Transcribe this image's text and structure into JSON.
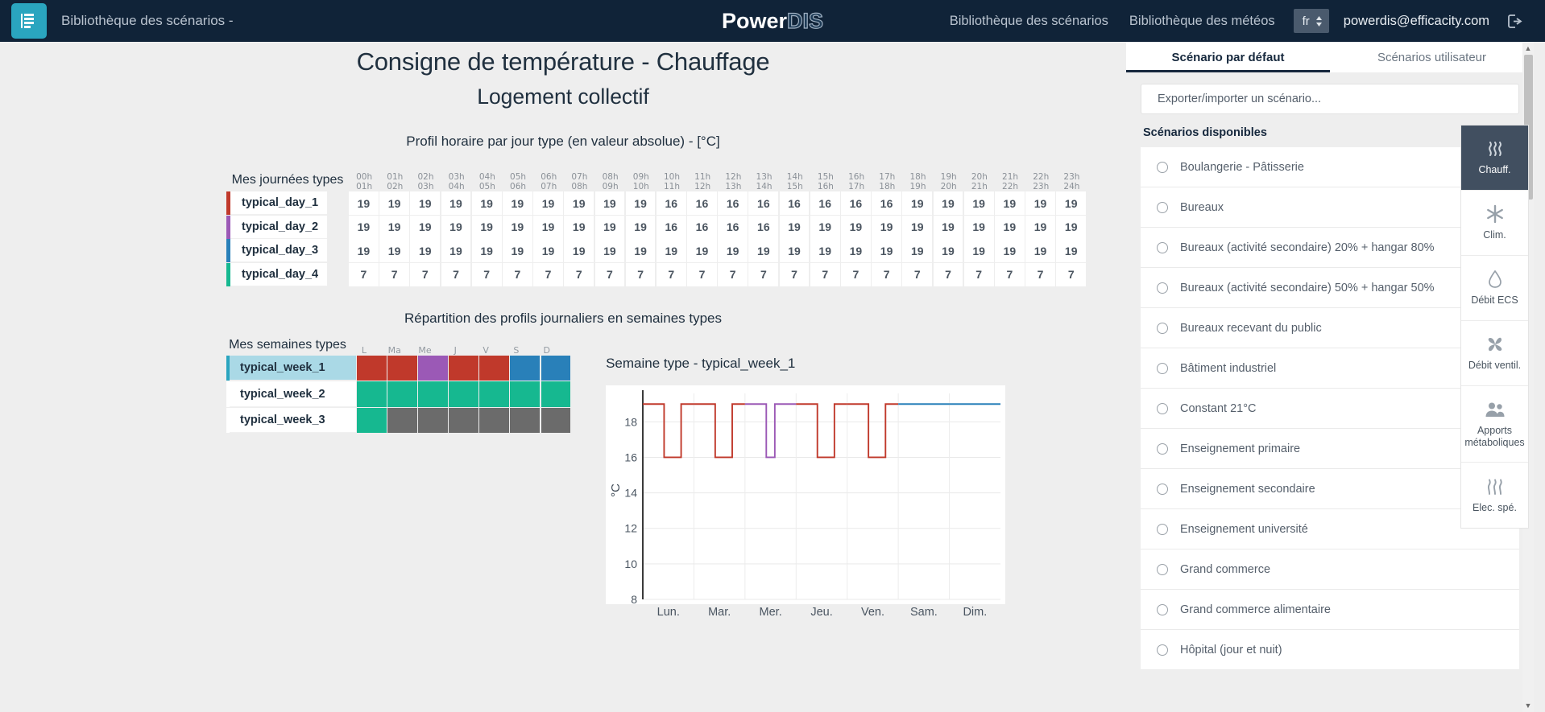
{
  "header": {
    "menu_icon": "hamburger-list-icon",
    "title": "Bibliothèque des scénarios -",
    "brand_part1": "Power",
    "brand_part2": "DIS",
    "nav": [
      {
        "label": "Bibliothèque des scénarios"
      },
      {
        "label": "Bibliothèque des météos"
      }
    ],
    "language": "fr",
    "email": "powerdis@efficacity.com",
    "logout_icon": "logout-icon"
  },
  "main": {
    "title": "Consigne de température - Chauffage",
    "subtitle": "Logement collectif",
    "day_section_caption": "Profil horaire par jour type (en valeur absolue) - [°C]",
    "week_section_caption": "Répartition des profils journaliers en semaines types",
    "day_table": {
      "row_header": "Mes journées types",
      "hour_labels": [
        [
          "00h",
          "01h"
        ],
        [
          "01h",
          "02h"
        ],
        [
          "02h",
          "03h"
        ],
        [
          "03h",
          "04h"
        ],
        [
          "04h",
          "05h"
        ],
        [
          "05h",
          "06h"
        ],
        [
          "06h",
          "07h"
        ],
        [
          "07h",
          "08h"
        ],
        [
          "08h",
          "09h"
        ],
        [
          "09h",
          "10h"
        ],
        [
          "10h",
          "11h"
        ],
        [
          "11h",
          "12h"
        ],
        [
          "12h",
          "13h"
        ],
        [
          "13h",
          "14h"
        ],
        [
          "14h",
          "15h"
        ],
        [
          "15h",
          "16h"
        ],
        [
          "16h",
          "17h"
        ],
        [
          "17h",
          "18h"
        ],
        [
          "18h",
          "19h"
        ],
        [
          "19h",
          "20h"
        ],
        [
          "20h",
          "21h"
        ],
        [
          "21h",
          "22h"
        ],
        [
          "22h",
          "23h"
        ],
        [
          "23h",
          "24h"
        ]
      ],
      "rows": [
        {
          "name": "typical_day_1",
          "color": "#c0392b",
          "values": [
            19,
            19,
            19,
            19,
            19,
            19,
            19,
            19,
            19,
            19,
            16,
            16,
            16,
            16,
            16,
            16,
            16,
            16,
            19,
            19,
            19,
            19,
            19,
            19
          ]
        },
        {
          "name": "typical_day_2",
          "color": "#9b59b6",
          "values": [
            19,
            19,
            19,
            19,
            19,
            19,
            19,
            19,
            19,
            19,
            16,
            16,
            16,
            16,
            19,
            19,
            19,
            19,
            19,
            19,
            19,
            19,
            19,
            19
          ]
        },
        {
          "name": "typical_day_3",
          "color": "#2980b9",
          "values": [
            19,
            19,
            19,
            19,
            19,
            19,
            19,
            19,
            19,
            19,
            19,
            19,
            19,
            19,
            19,
            19,
            19,
            19,
            19,
            19,
            19,
            19,
            19,
            19
          ]
        },
        {
          "name": "typical_day_4",
          "color": "#16b890",
          "values": [
            7,
            7,
            7,
            7,
            7,
            7,
            7,
            7,
            7,
            7,
            7,
            7,
            7,
            7,
            7,
            7,
            7,
            7,
            7,
            7,
            7,
            7,
            7,
            7
          ]
        }
      ]
    },
    "week_table": {
      "row_header": "Mes semaines types",
      "day_labels": [
        "L",
        "Ma",
        "Me",
        "J",
        "V",
        "S",
        "D"
      ],
      "rows": [
        {
          "name": "typical_week_1",
          "selected": true,
          "colors": [
            "#c0392b",
            "#c0392b",
            "#9b59b6",
            "#c0392b",
            "#c0392b",
            "#2980b9",
            "#2980b9"
          ]
        },
        {
          "name": "typical_week_2",
          "selected": false,
          "colors": [
            "#16b890",
            "#16b890",
            "#16b890",
            "#16b890",
            "#16b890",
            "#16b890",
            "#16b890"
          ]
        },
        {
          "name": "typical_week_3",
          "selected": false,
          "colors": [
            "#16b890",
            "#6b6b6b",
            "#6b6b6b",
            "#6b6b6b",
            "#6b6b6b",
            "#6b6b6b",
            "#6b6b6b"
          ]
        }
      ]
    },
    "chart_title": "Semaine type - typical_week_1"
  },
  "chart_data": {
    "type": "line",
    "title": "Semaine type - typical_week_1",
    "xlabel": "",
    "ylabel": "°C",
    "ylim": [
      8,
      19.6
    ],
    "yticks": [
      8,
      10,
      12,
      14,
      16,
      18
    ],
    "xticks": [
      "Lun.",
      "Mar.",
      "Mer.",
      "Jeu.",
      "Ven.",
      "Sam.",
      "Dim."
    ],
    "grid": true,
    "step": "post",
    "legend": "none",
    "series": [
      {
        "name": "typical_day_1",
        "color": "#c0392b",
        "days": [
          "Lun.",
          "Mar.",
          "Jeu.",
          "Ven."
        ],
        "values": [
          19,
          19,
          19,
          19,
          19,
          19,
          19,
          19,
          19,
          19,
          16,
          16,
          16,
          16,
          16,
          16,
          16,
          16,
          19,
          19,
          19,
          19,
          19,
          19
        ]
      },
      {
        "name": "typical_day_2",
        "color": "#9b59b6",
        "days": [
          "Mer."
        ],
        "values": [
          19,
          19,
          19,
          19,
          19,
          19,
          19,
          19,
          19,
          19,
          16,
          16,
          16,
          16,
          19,
          19,
          19,
          19,
          19,
          19,
          19,
          19,
          19,
          19
        ]
      },
      {
        "name": "typical_day_3",
        "color": "#2980b9",
        "days": [
          "Sam.",
          "Dim."
        ],
        "values": [
          19,
          19,
          19,
          19,
          19,
          19,
          19,
          19,
          19,
          19,
          19,
          19,
          19,
          19,
          19,
          19,
          19,
          19,
          19,
          19,
          19,
          19,
          19,
          19
        ]
      }
    ],
    "week_order": [
      "typical_day_1",
      "typical_day_1",
      "typical_day_2",
      "typical_day_1",
      "typical_day_1",
      "typical_day_3",
      "typical_day_3"
    ]
  },
  "right_panel": {
    "tabs": [
      {
        "label": "Scénario par défaut",
        "active": true
      },
      {
        "label": "Scénarios utilisateur",
        "active": false
      }
    ],
    "export_label": "Exporter/importer un scénario...",
    "available_title": "Scénarios disponibles",
    "scenarios": [
      {
        "label": "Boulangerie - Pâtisserie"
      },
      {
        "label": "Bureaux"
      },
      {
        "label": "Bureaux (activité secondaire) 20% + hangar 80%"
      },
      {
        "label": "Bureaux (activité secondaire) 50% + hangar 50%"
      },
      {
        "label": "Bureaux recevant du public"
      },
      {
        "label": "Bâtiment industriel"
      },
      {
        "label": "Constant 21°C"
      },
      {
        "label": "Enseignement primaire"
      },
      {
        "label": "Enseignement secondaire"
      },
      {
        "label": "Enseignement université"
      },
      {
        "label": "Grand commerce"
      },
      {
        "label": "Grand commerce alimentaire"
      },
      {
        "label": "Hôpital (jour et nuit)"
      }
    ]
  },
  "rail": [
    {
      "label": "Chauff.",
      "icon": "heating-waves-icon",
      "active": true
    },
    {
      "label": "Clim.",
      "icon": "snowflake-icon",
      "active": false
    },
    {
      "label": "Débit ECS",
      "icon": "water-drop-icon",
      "active": false
    },
    {
      "label": "Débit ventil.",
      "icon": "fan-icon",
      "active": false
    },
    {
      "label": "Apports métaboliques",
      "icon": "people-icon",
      "active": false
    },
    {
      "label": "Elec. spé.",
      "icon": "heat-rising-icon",
      "active": false
    }
  ],
  "colors": {
    "topbar": "#102338",
    "accent_teal": "#2aa5bf",
    "day1": "#c0392b",
    "day2": "#9b59b6",
    "day3": "#2980b9",
    "day4": "#16b890",
    "gray": "#6b6b6b",
    "selected_row": "#aad9e6"
  }
}
